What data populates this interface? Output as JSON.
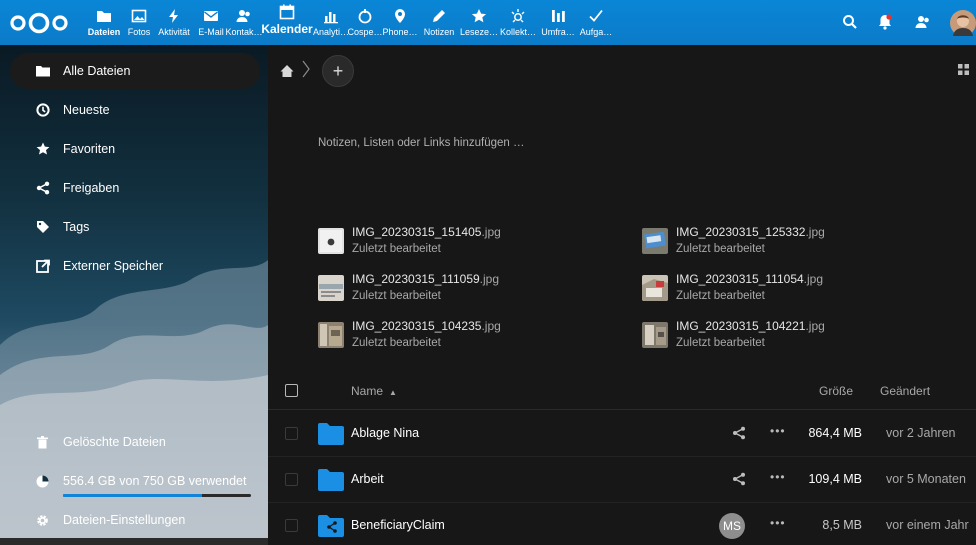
{
  "header": {
    "apps": [
      {
        "label": "Dateien",
        "icon": "folder-icon",
        "active": true
      },
      {
        "label": "Fotos",
        "icon": "image-icon"
      },
      {
        "label": "Aktivität",
        "icon": "bolt-icon"
      },
      {
        "label": "E-Mail",
        "icon": "mail-icon"
      },
      {
        "label": "Kontak…",
        "icon": "contacts-icon"
      },
      {
        "label": "Kalender",
        "icon": "calendar-icon",
        "big": true
      },
      {
        "label": "Analyti…",
        "icon": "bar-chart-icon"
      },
      {
        "label": "Cospe…",
        "icon": "coins-icon"
      },
      {
        "label": "Phone…",
        "icon": "location-pin-icon"
      },
      {
        "label": "Notizen",
        "icon": "pencil-icon"
      },
      {
        "label": "Leseze…",
        "icon": "star-icon"
      },
      {
        "label": "Kollekt…",
        "icon": "sparkle-icon"
      },
      {
        "label": "Umfra…",
        "icon": "poll-icon"
      },
      {
        "label": "Aufga…",
        "icon": "check-icon"
      }
    ]
  },
  "sidebar": {
    "items": [
      {
        "label": "Alle Dateien",
        "icon": "folder-icon",
        "active": true
      },
      {
        "label": "Neueste",
        "icon": "clock-icon"
      },
      {
        "label": "Favoriten",
        "icon": "star-icon"
      },
      {
        "label": "Freigaben",
        "icon": "share-icon"
      },
      {
        "label": "Tags",
        "icon": "tag-icon"
      },
      {
        "label": "Externer Speicher",
        "icon": "external-storage-icon"
      }
    ],
    "trash": "Gelöschte Dateien",
    "quota": {
      "label": "556.4 GB von 750 GB verwendet",
      "used_fraction": 0.742
    },
    "settings": "Dateien-Einstellungen"
  },
  "main": {
    "rich_workspace_placeholder": "Notizen, Listen oder Links hinzufügen …",
    "recent": [
      {
        "base": "IMG_20230315_151405",
        "ext": ".jpg",
        "sub": "Zuletzt bearbeitet"
      },
      {
        "base": "IMG_20230315_125332",
        "ext": ".jpg",
        "sub": "Zuletzt bearbeitet"
      },
      {
        "base": "IMG_20230315_111059",
        "ext": ".jpg",
        "sub": "Zuletzt bearbeitet"
      },
      {
        "base": "IMG_20230315_111054",
        "ext": ".jpg",
        "sub": "Zuletzt bearbeitet"
      },
      {
        "base": "IMG_20230315_104235",
        "ext": ".jpg",
        "sub": "Zuletzt bearbeitet"
      },
      {
        "base": "IMG_20230315_104221",
        "ext": ".jpg",
        "sub": "Zuletzt bearbeitet"
      }
    ],
    "table": {
      "headers": {
        "name": "Name",
        "size": "Größe",
        "modified": "Geändert"
      },
      "rows": [
        {
          "name": "Ablage Nina",
          "size": "864,4 MB",
          "modified": "vor 2 Jahren",
          "shared_icon": "share-icon"
        },
        {
          "name": "Arbeit",
          "size": "109,4 MB",
          "modified": "vor 5 Monaten",
          "shared_icon": "share-icon"
        },
        {
          "name": "BeneficiaryClaim",
          "size": "8,5 MB",
          "modified": "vor einem Jahr",
          "owner_initials": "MS"
        }
      ]
    }
  },
  "colors": {
    "header": "#0b7bc8",
    "accent": "#1284d8",
    "folder": "#1a8fe3",
    "background": "#171717"
  }
}
